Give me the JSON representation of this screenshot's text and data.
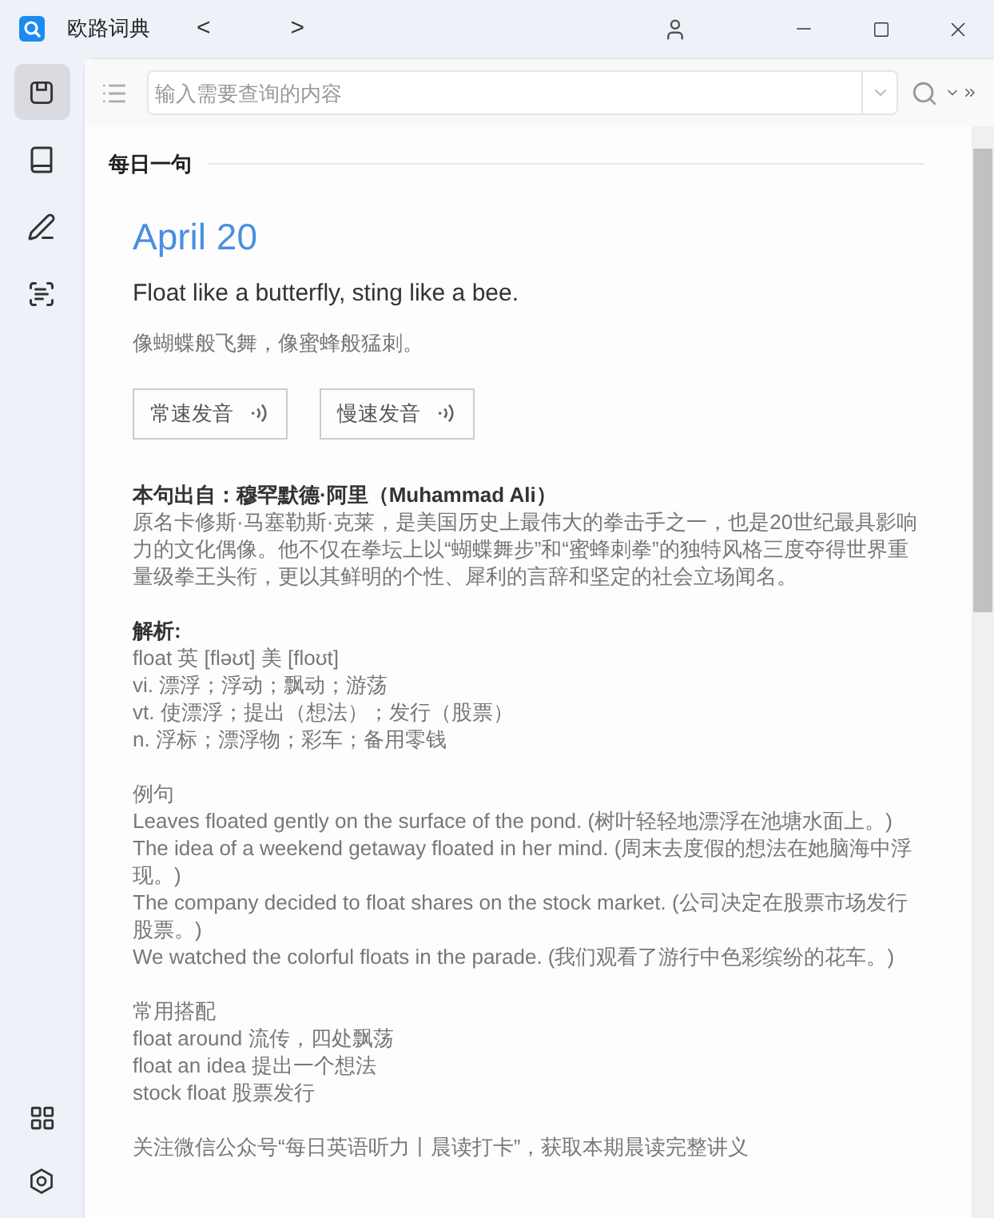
{
  "window": {
    "title": "欧路词典",
    "back": "<",
    "forward": ">"
  },
  "sidebar": {
    "items": [
      {
        "selected": true
      },
      {
        "selected": false
      },
      {
        "selected": false
      },
      {
        "selected": false
      }
    ]
  },
  "search": {
    "placeholder": "输入需要查询的内容"
  },
  "section": {
    "title": "每日一句"
  },
  "daily": {
    "date": "April 20",
    "sentence": "Float like a butterfly, sting like a bee.",
    "translation": "像蝴蝶般飞舞，像蜜蜂般猛刺。",
    "buttons": [
      "常速发音",
      "慢速发音"
    ],
    "source_title": "本句出自：穆罕默德·阿里（Muhammad Ali）",
    "source_text": "原名卡修斯·马塞勒斯·克莱，是美国历史上最伟大的拳击手之一，也是20世纪最具影响力的文化偶像。他不仅在拳坛上以“蝴蝶舞步”和“蜜蜂刺拳”的独特风格三度夺得世界重量级拳王头衔，更以其鲜明的个性、犀利的言辞和坚定的社会立场闻名。",
    "analysis_title": "解析:",
    "analysis_lines": [
      "float 英 [fləʊt] 美 [floʊt]",
      "vi. 漂浮；浮动；飘动；游荡",
      "vt. 使漂浮；提出（想法）；发行（股票）",
      "n. 浮标；漂浮物；彩车；备用零钱"
    ],
    "examples_title": "例句",
    "examples": [
      "Leaves floated gently on the surface of the pond. (树叶轻轻地漂浮在池塘水面上。)",
      "The idea of a weekend getaway floated in her mind. (周末去度假的想法在她脑海中浮现。)",
      "The company decided to float shares on the stock market. (公司决定在股票市场发行股票。)",
      "We watched the colorful floats in the parade. (我们观看了游行中色彩缤纷的花车。)"
    ],
    "collocations_title": "常用搭配",
    "collocations": [
      "float around 流传，四处飘荡",
      "float an idea 提出一个想法",
      "stock float 股票发行"
    ],
    "footer": "关注微信公众号“每日英语听力丨晨读打卡”，获取本期晨读完整讲义"
  }
}
